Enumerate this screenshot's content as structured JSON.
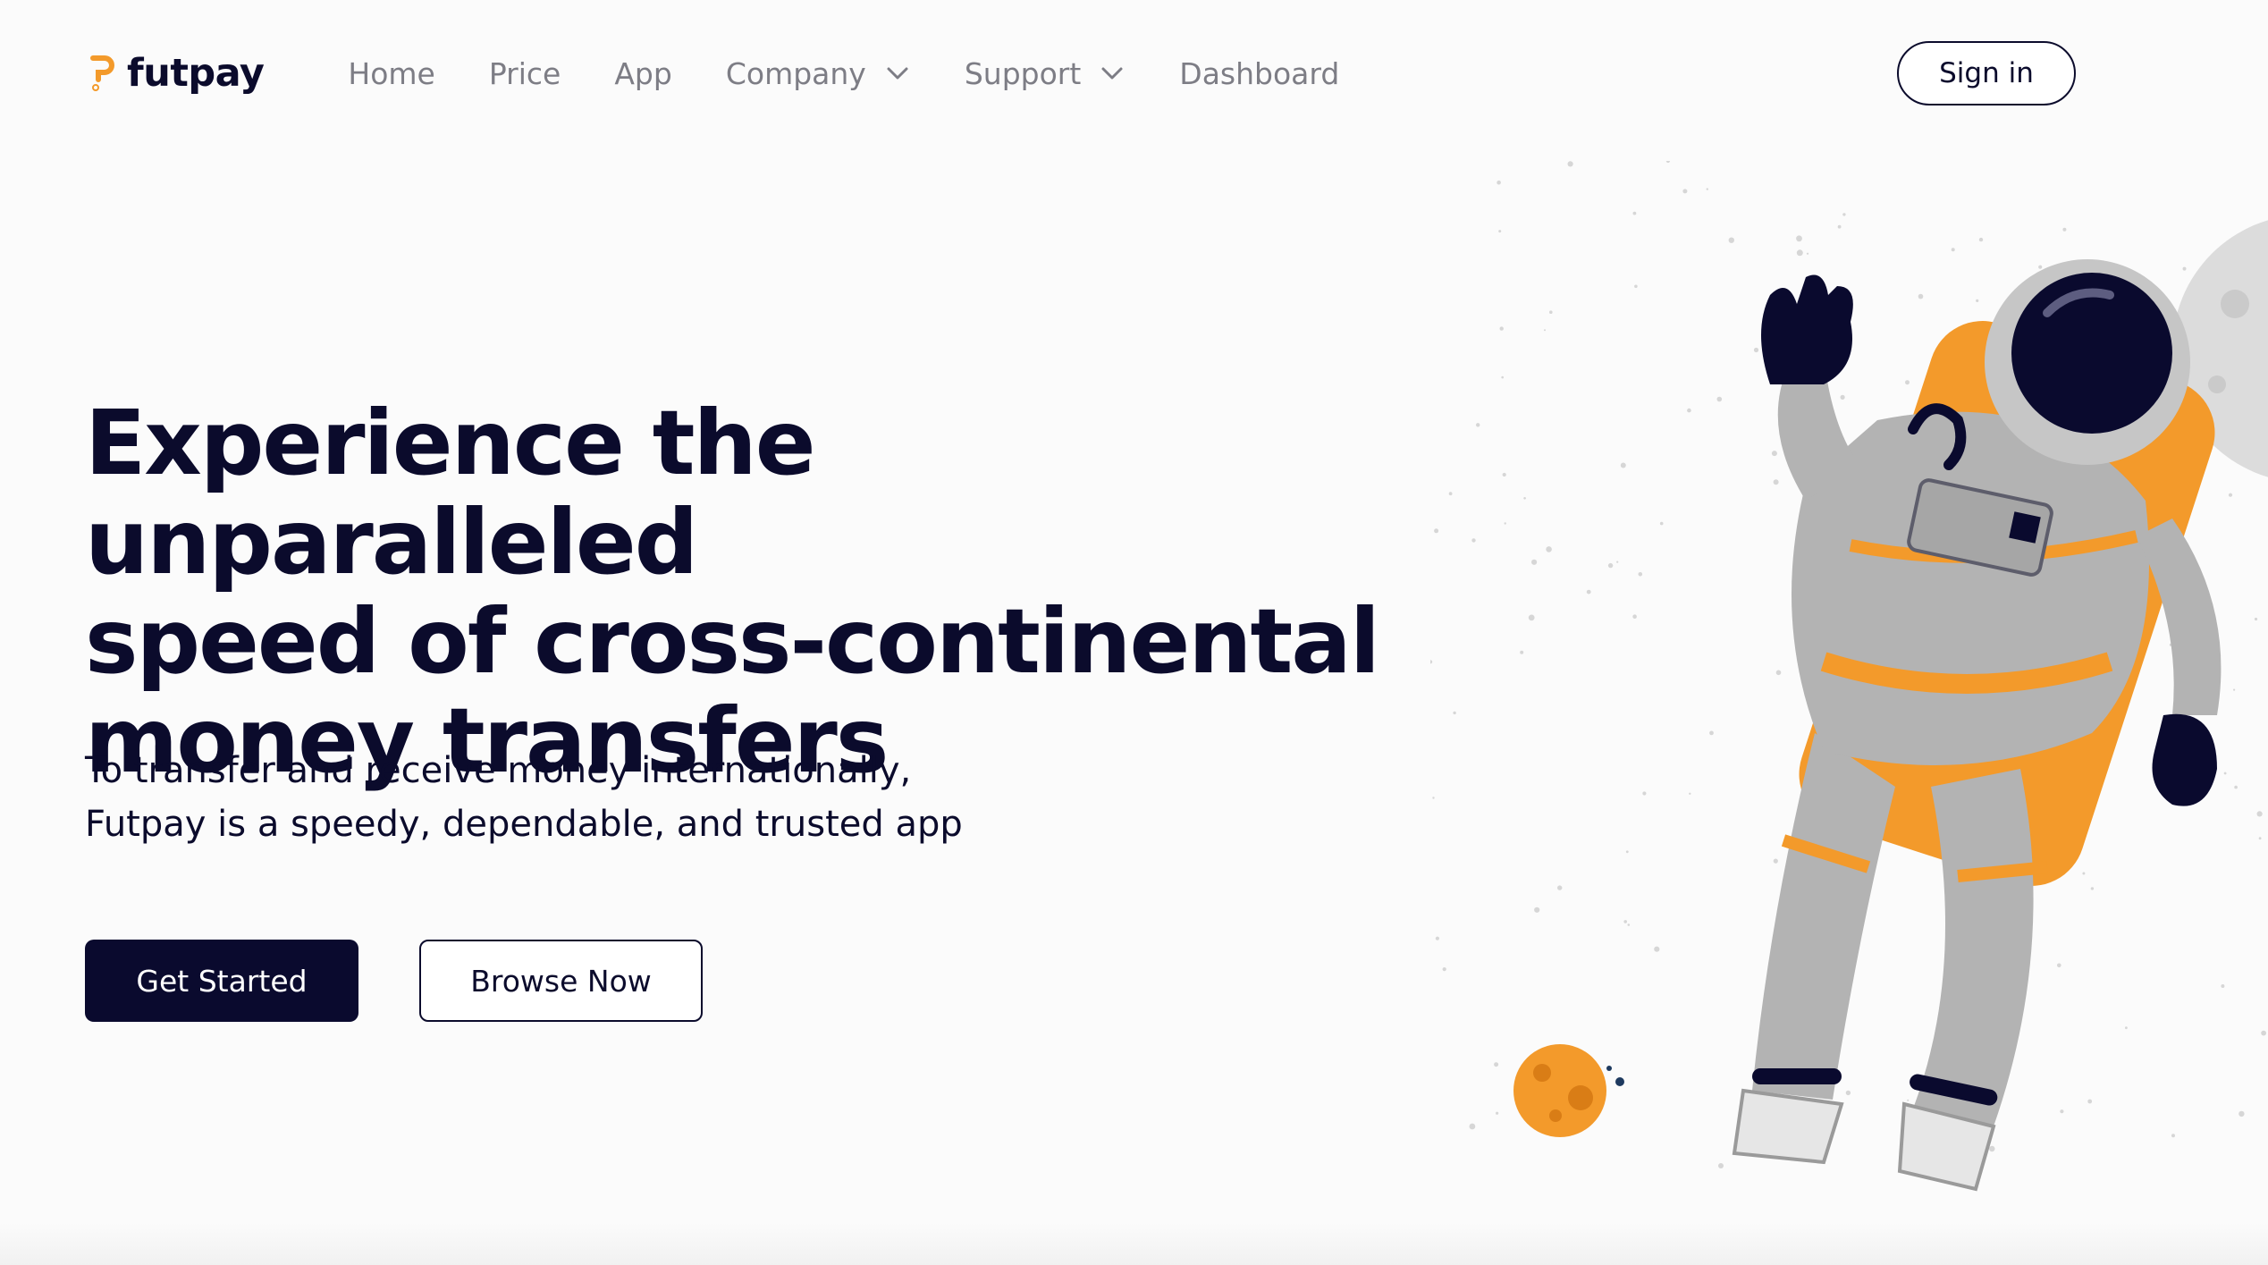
{
  "brand": {
    "name": "futpay",
    "accent_color": "#f39a2b",
    "dark_color": "#0b0b2c"
  },
  "nav": {
    "items": [
      {
        "label": "Home",
        "has_dropdown": false
      },
      {
        "label": "Price",
        "has_dropdown": false
      },
      {
        "label": "App",
        "has_dropdown": false
      },
      {
        "label": "Company",
        "has_dropdown": true
      },
      {
        "label": "Support",
        "has_dropdown": true
      },
      {
        "label": "Dashboard",
        "has_dropdown": false
      }
    ],
    "signin_label": "Sign in"
  },
  "hero": {
    "title_lines": [
      "Experience the unparalleled",
      "speed of cross-continental",
      "money transfers"
    ],
    "subtitle_lines": [
      "To transfer and receive money internationally,",
      "Futpay is a speedy, dependable, and trusted app"
    ],
    "primary_button": "Get Started",
    "secondary_button": "Browse Now"
  },
  "illustration": {
    "icons": [
      "astronaut-illustration",
      "orange-planet-icon",
      "moon-icon",
      "star-dust"
    ]
  }
}
